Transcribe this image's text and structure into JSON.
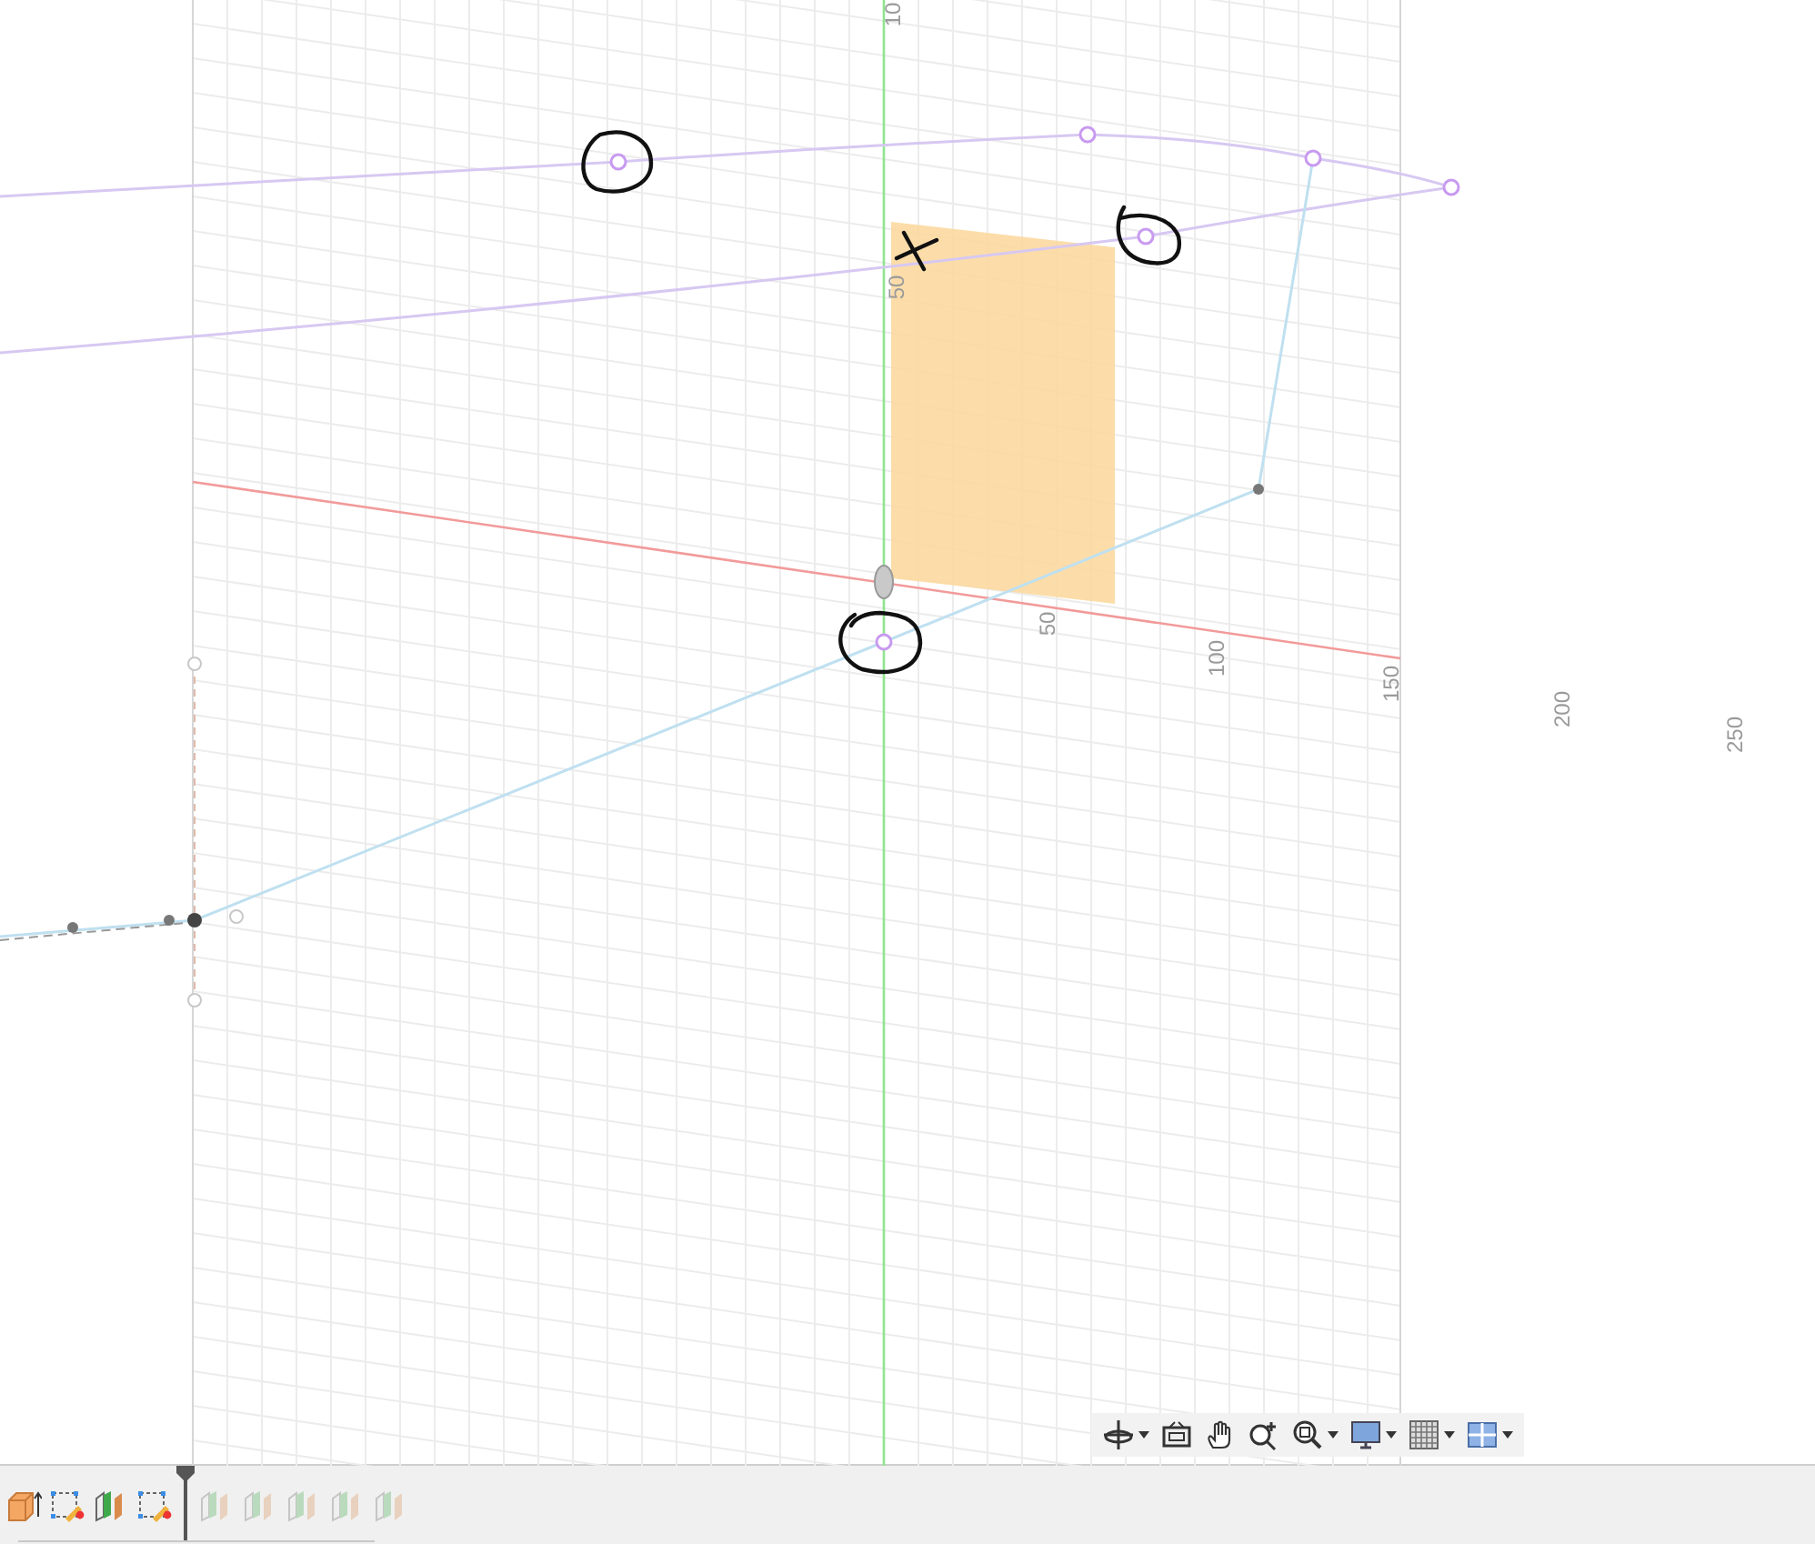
{
  "viewport": {
    "axis_labels": [
      "10",
      "50",
      "50",
      "100",
      "150",
      "200",
      "250"
    ]
  },
  "navigation_toolbar": [
    {
      "kind": "orbit",
      "dropdown": true
    },
    {
      "kind": "look_at",
      "dropdown": false
    },
    {
      "kind": "pan",
      "dropdown": false
    },
    {
      "kind": "zoom",
      "dropdown": false
    },
    {
      "kind": "fit",
      "dropdown": true
    },
    {
      "kind": "display",
      "dropdown": true
    },
    {
      "kind": "grid",
      "dropdown": true
    },
    {
      "kind": "viewports",
      "dropdown": true
    }
  ],
  "timeline": {
    "features": [
      {
        "kind": "extrude",
        "rolled_back": false
      },
      {
        "kind": "sketch",
        "rolled_back": false
      },
      {
        "kind": "surface",
        "rolled_back": false
      },
      {
        "kind": "sketch",
        "rolled_back": false
      },
      {
        "kind": "surface",
        "rolled_back": true
      },
      {
        "kind": "surface",
        "rolled_back": true
      },
      {
        "kind": "surface",
        "rolled_back": true
      },
      {
        "kind": "surface",
        "rolled_back": true
      },
      {
        "kind": "surface",
        "rolled_back": true
      }
    ]
  }
}
